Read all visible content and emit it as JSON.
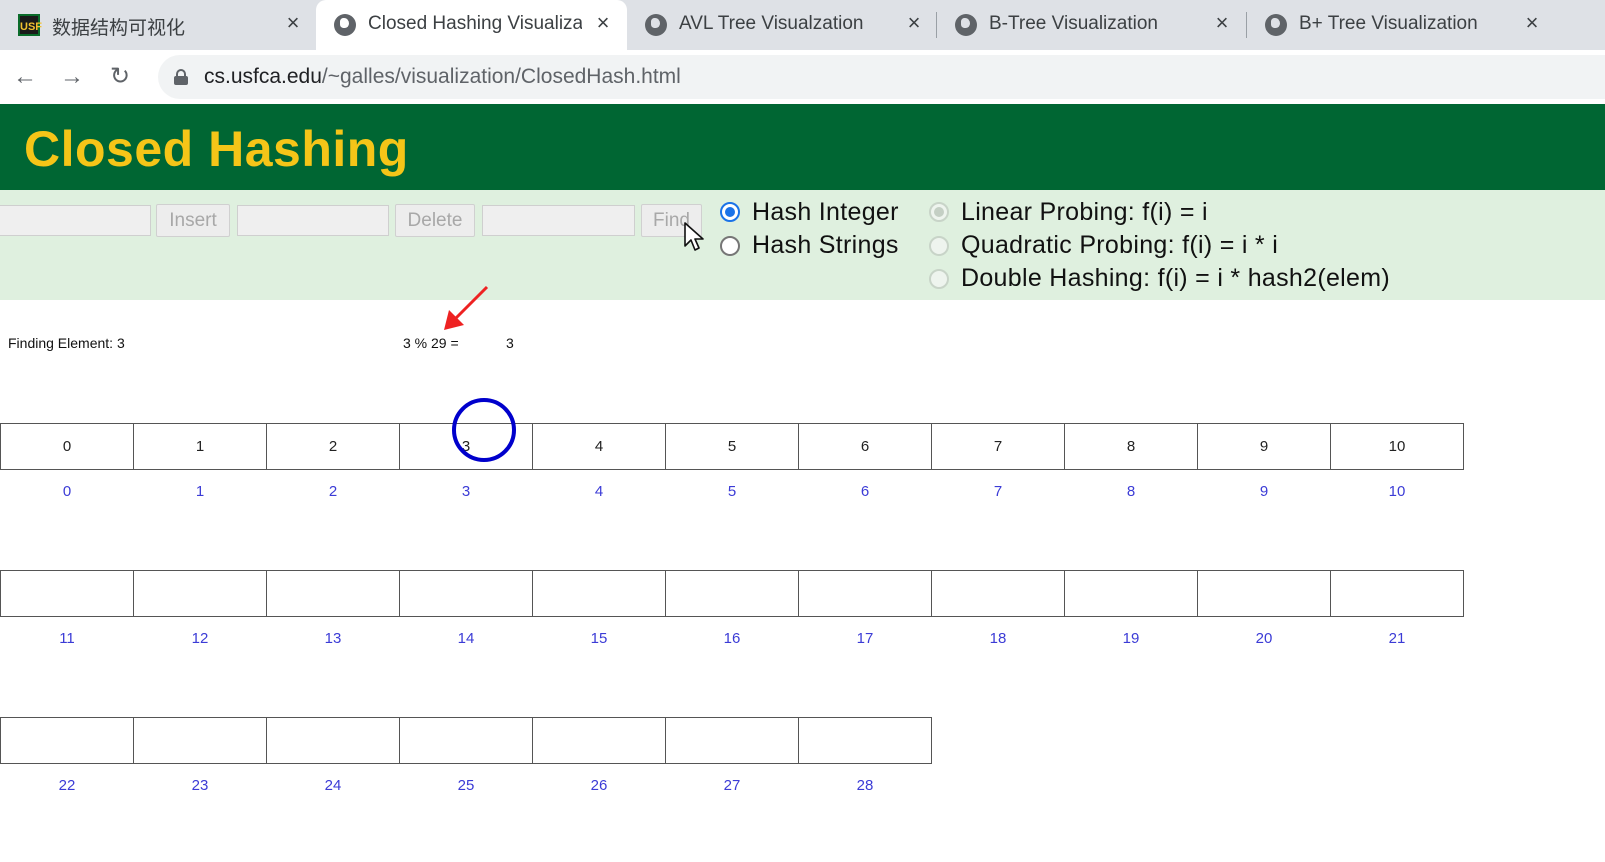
{
  "browser": {
    "tabs": [
      {
        "title": "数据结构可视化",
        "favicon": "usf-logo-icon",
        "active": false
      },
      {
        "title": "Closed Hashing Visualization",
        "favicon": "globe-icon",
        "active": true
      },
      {
        "title": "AVL Tree Visualzation",
        "favicon": "globe-icon",
        "active": false
      },
      {
        "title": "B-Tree Visualization",
        "favicon": "globe-icon",
        "active": false
      },
      {
        "title": "B+ Tree Visualization",
        "favicon": "globe-icon",
        "active": false
      }
    ],
    "close_glyph": "×",
    "favicon_usf_text": "USF",
    "nav": {
      "back": "←",
      "forward": "→",
      "reload": "↻"
    },
    "url_host": "cs.usfca.edu",
    "url_path": "/~galles/visualization/ClosedHash.html"
  },
  "page": {
    "title": "Closed Hashing",
    "controls": {
      "insert_label": "Insert",
      "delete_label": "Delete",
      "find_label": "Find",
      "insert_value": "",
      "delete_value": "",
      "find_value": ""
    },
    "hash_type": [
      {
        "label": "Hash Integer",
        "checked": true
      },
      {
        "label": "Hash Strings",
        "checked": false
      }
    ],
    "probing": [
      {
        "label": "Linear Probing: f(i) = i",
        "checked": true,
        "disabled": true
      },
      {
        "label": "Quadratic Probing: f(i) = i * i",
        "checked": false,
        "disabled": true
      },
      {
        "label": "Double Hashing: f(i) = i * hash2(elem)",
        "checked": false,
        "disabled": true
      }
    ]
  },
  "canvas": {
    "status": "Finding Element: 3",
    "hash_expr": "3 % 29 =",
    "hash_result": "3",
    "table_size": 29,
    "highlighted_index": 3,
    "cells": [
      "0",
      "1",
      "2",
      "3",
      "4",
      "5",
      "6",
      "7",
      "8",
      "9",
      "10",
      "",
      "",
      "",
      "",
      "",
      "",
      "",
      "",
      "",
      "",
      "",
      "",
      "",
      "",
      "",
      "",
      "",
      ""
    ],
    "indices": [
      "0",
      "1",
      "2",
      "3",
      "4",
      "5",
      "6",
      "7",
      "8",
      "9",
      "10",
      "11",
      "12",
      "13",
      "14",
      "15",
      "16",
      "17",
      "18",
      "19",
      "20",
      "21",
      "22",
      "23",
      "24",
      "25",
      "26",
      "27",
      "28"
    ],
    "colors": {
      "index": "#3b3bd6",
      "circle": "#0000cc",
      "arrow": "#ee2222",
      "header_bg": "#006633",
      "title": "#f5c518"
    }
  }
}
